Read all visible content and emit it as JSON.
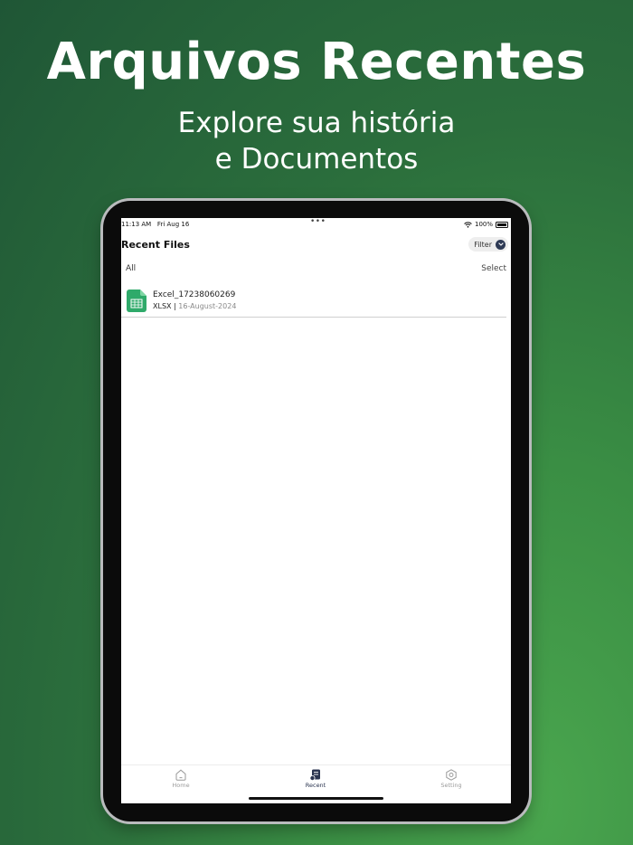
{
  "promo": {
    "headline": "Arquivos Recentes",
    "subline_1": "Explore sua história",
    "subline_2": "e Documentos"
  },
  "status_bar": {
    "time": "11:13 AM",
    "date": "Fri Aug 16",
    "battery": "100%"
  },
  "nav": {
    "title": "Recent Files",
    "filter_label": "Filter"
  },
  "segment": {
    "all_label": "All",
    "select_label": "Select"
  },
  "files": [
    {
      "name": "Excel_17238060269",
      "type": "XLSX",
      "separator": " | ",
      "date": "16-August-2024"
    }
  ],
  "tabbar": {
    "home": "Home",
    "recent": "Recent",
    "setting": "Setting",
    "active": "recent"
  },
  "colors": {
    "background_dark": "#1f5636",
    "background_light": "#4aa64e",
    "accent": "#2e3a55",
    "file_icon": "#2faa6a"
  }
}
